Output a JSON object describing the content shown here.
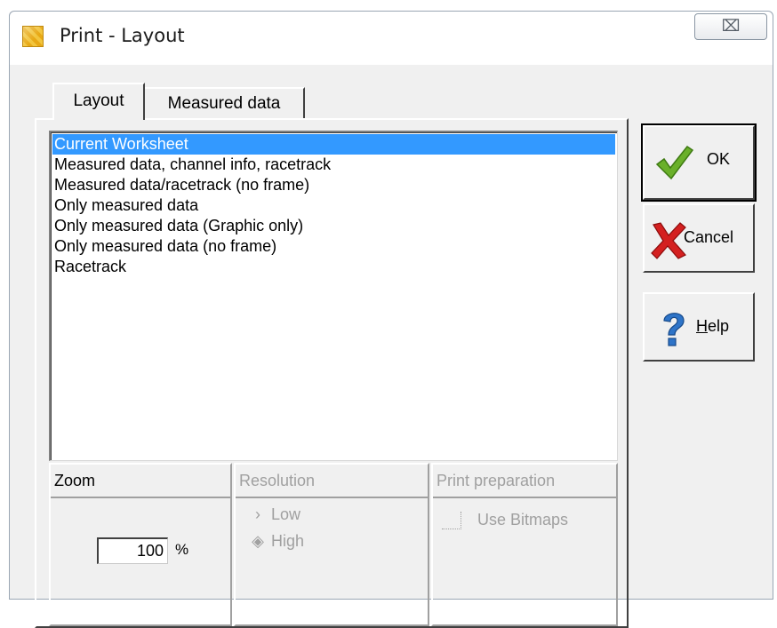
{
  "window": {
    "title": "Print - Layout",
    "close_glyph": "⌧"
  },
  "tabs": [
    {
      "label": "Layout",
      "active": true
    },
    {
      "label": "Measured data",
      "active": false
    }
  ],
  "layouts": {
    "items": [
      "Current Worksheet",
      "Measured data, channel info, racetrack",
      "Measured data/racetrack (no frame)",
      "Only measured data",
      "Only measured data (Graphic only)",
      "Only measured data (no frame)",
      "Racetrack"
    ],
    "selected": "Current Worksheet"
  },
  "zoom": {
    "label": "Zoom",
    "value": "100",
    "unit": "%"
  },
  "resolution": {
    "label": "Resolution",
    "options": [
      "Low",
      "High"
    ],
    "selected": "High",
    "enabled": false
  },
  "print_preparation": {
    "label": "Print preparation",
    "use_bitmaps_label": "Use Bitmaps",
    "use_bitmaps_checked": false,
    "enabled": false
  },
  "buttons": {
    "ok": "OK",
    "cancel": "Cancel",
    "help_mnemonic": "H",
    "help_rest": "elp"
  },
  "icons": {
    "app": "app-grid-icon",
    "ok": "checkmark-icon",
    "cancel": "red-x-icon",
    "help": "question-mark-icon"
  },
  "colors": {
    "selection": "#3399ff",
    "ok_check": "#6ab02a",
    "cancel_x": "#d42020",
    "help_q": "#2e74c8"
  }
}
